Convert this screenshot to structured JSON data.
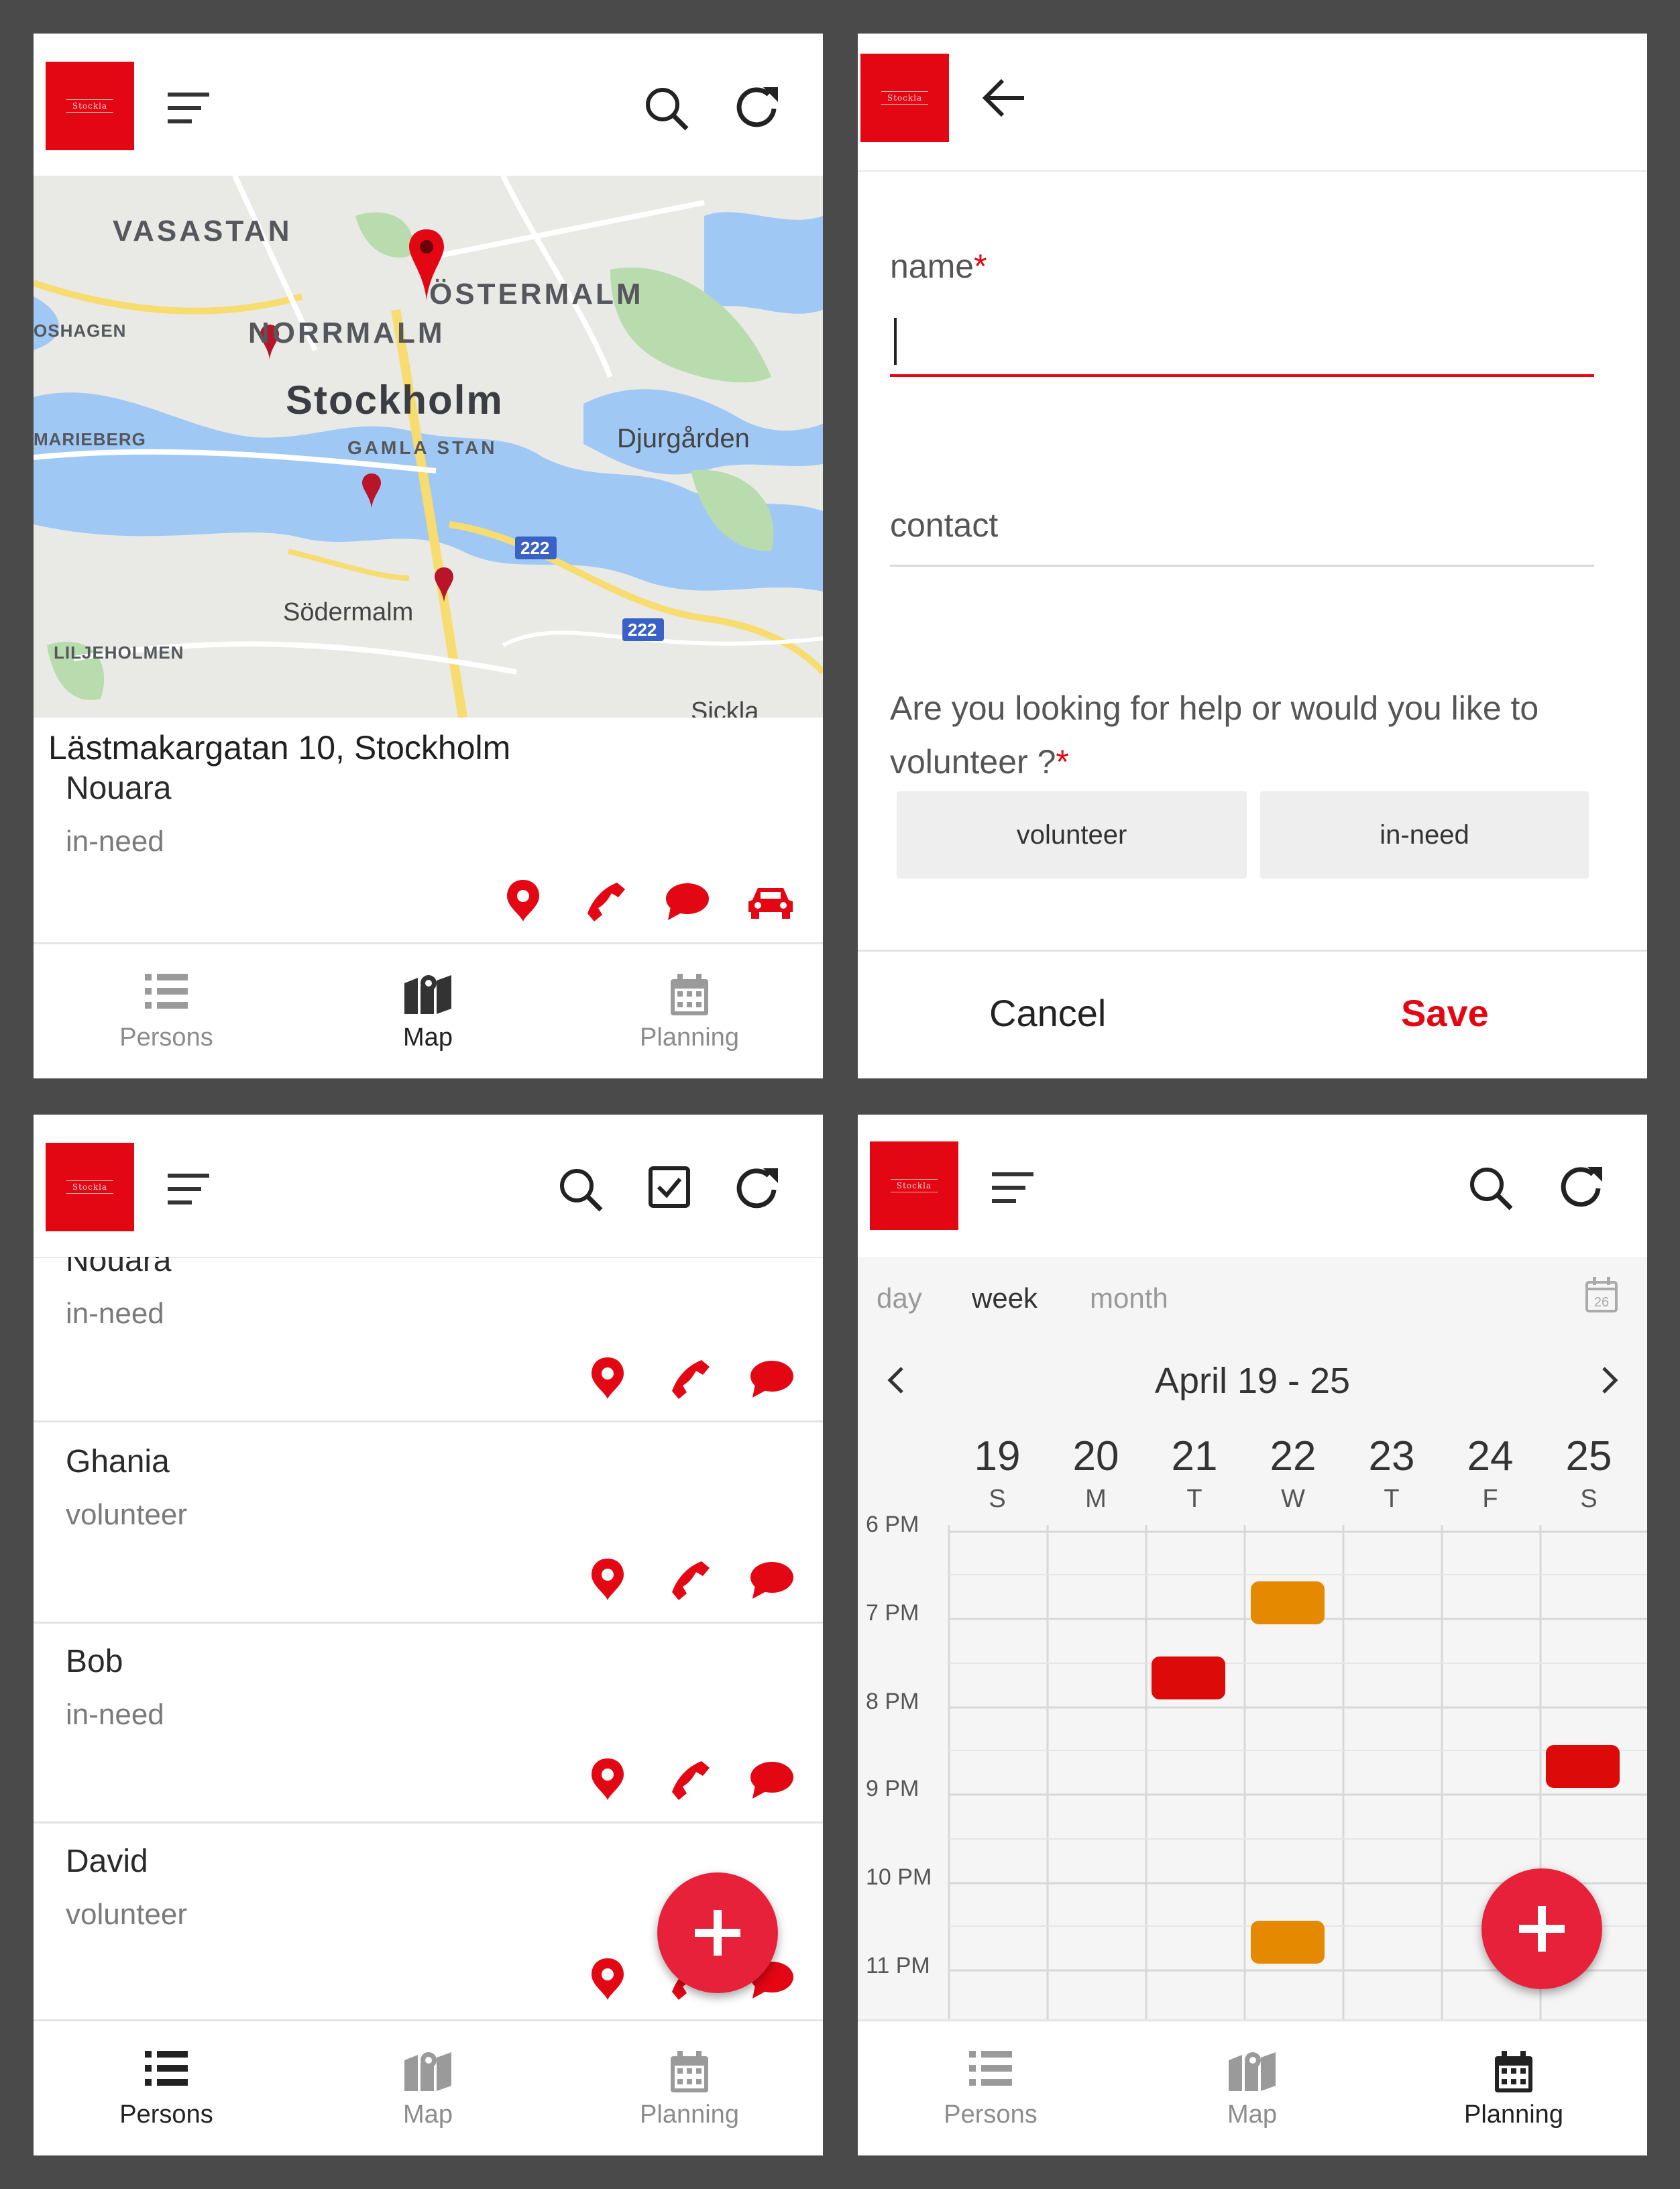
{
  "map_screen": {
    "map_labels": {
      "vasastan": "VASASTAN",
      "ostermalm": "ÖSTERMALM",
      "norrmalm": "NORRMALM",
      "stockholm": "Stockholm",
      "gamla_stan": "GAMLA STAN",
      "djurgarden": "Djurgården",
      "sodermalm": "Södermalm",
      "liljeholmen": "LILJEHOLMEN",
      "marieberg": "MARIEBERG",
      "oshagen": "OSHAGEN",
      "sickla": "Sickla",
      "route_222": "222"
    },
    "address": "Lästmakargatan 10, Stockholm",
    "person": {
      "name": "Nouara",
      "role": "in-need"
    }
  },
  "nav": {
    "persons": "Persons",
    "map": "Map",
    "planning": "Planning"
  },
  "form_screen": {
    "name_label": "name",
    "contact_label": "contact",
    "question": "Are you looking for help or would you like to volunteer ?",
    "required_mark": "*",
    "choices": [
      "volunteer",
      "in-need"
    ],
    "cancel": "Cancel",
    "save": "Save"
  },
  "persons_screen": {
    "persons": [
      {
        "name": "Nouara",
        "role": "in-need"
      },
      {
        "name": "Ghania",
        "role": "volunteer"
      },
      {
        "name": "Bob",
        "role": "in-need"
      },
      {
        "name": "David",
        "role": "volunteer"
      }
    ]
  },
  "planning_screen": {
    "views": [
      "day",
      "week",
      "month"
    ],
    "calendar_icon_day": "26",
    "range": "April 19 - 25",
    "days": [
      {
        "num": "19",
        "letter": "S"
      },
      {
        "num": "20",
        "letter": "M"
      },
      {
        "num": "21",
        "letter": "T"
      },
      {
        "num": "22",
        "letter": "W"
      },
      {
        "num": "23",
        "letter": "T"
      },
      {
        "num": "24",
        "letter": "F"
      },
      {
        "num": "25",
        "letter": "S"
      }
    ],
    "hours": [
      "6 PM",
      "7 PM",
      "8 PM",
      "9 PM",
      "10 PM",
      "11 PM"
    ]
  },
  "colors": {
    "accent": "#e30613",
    "event_orange": "#e58a00",
    "event_red": "#dd0a0a"
  }
}
